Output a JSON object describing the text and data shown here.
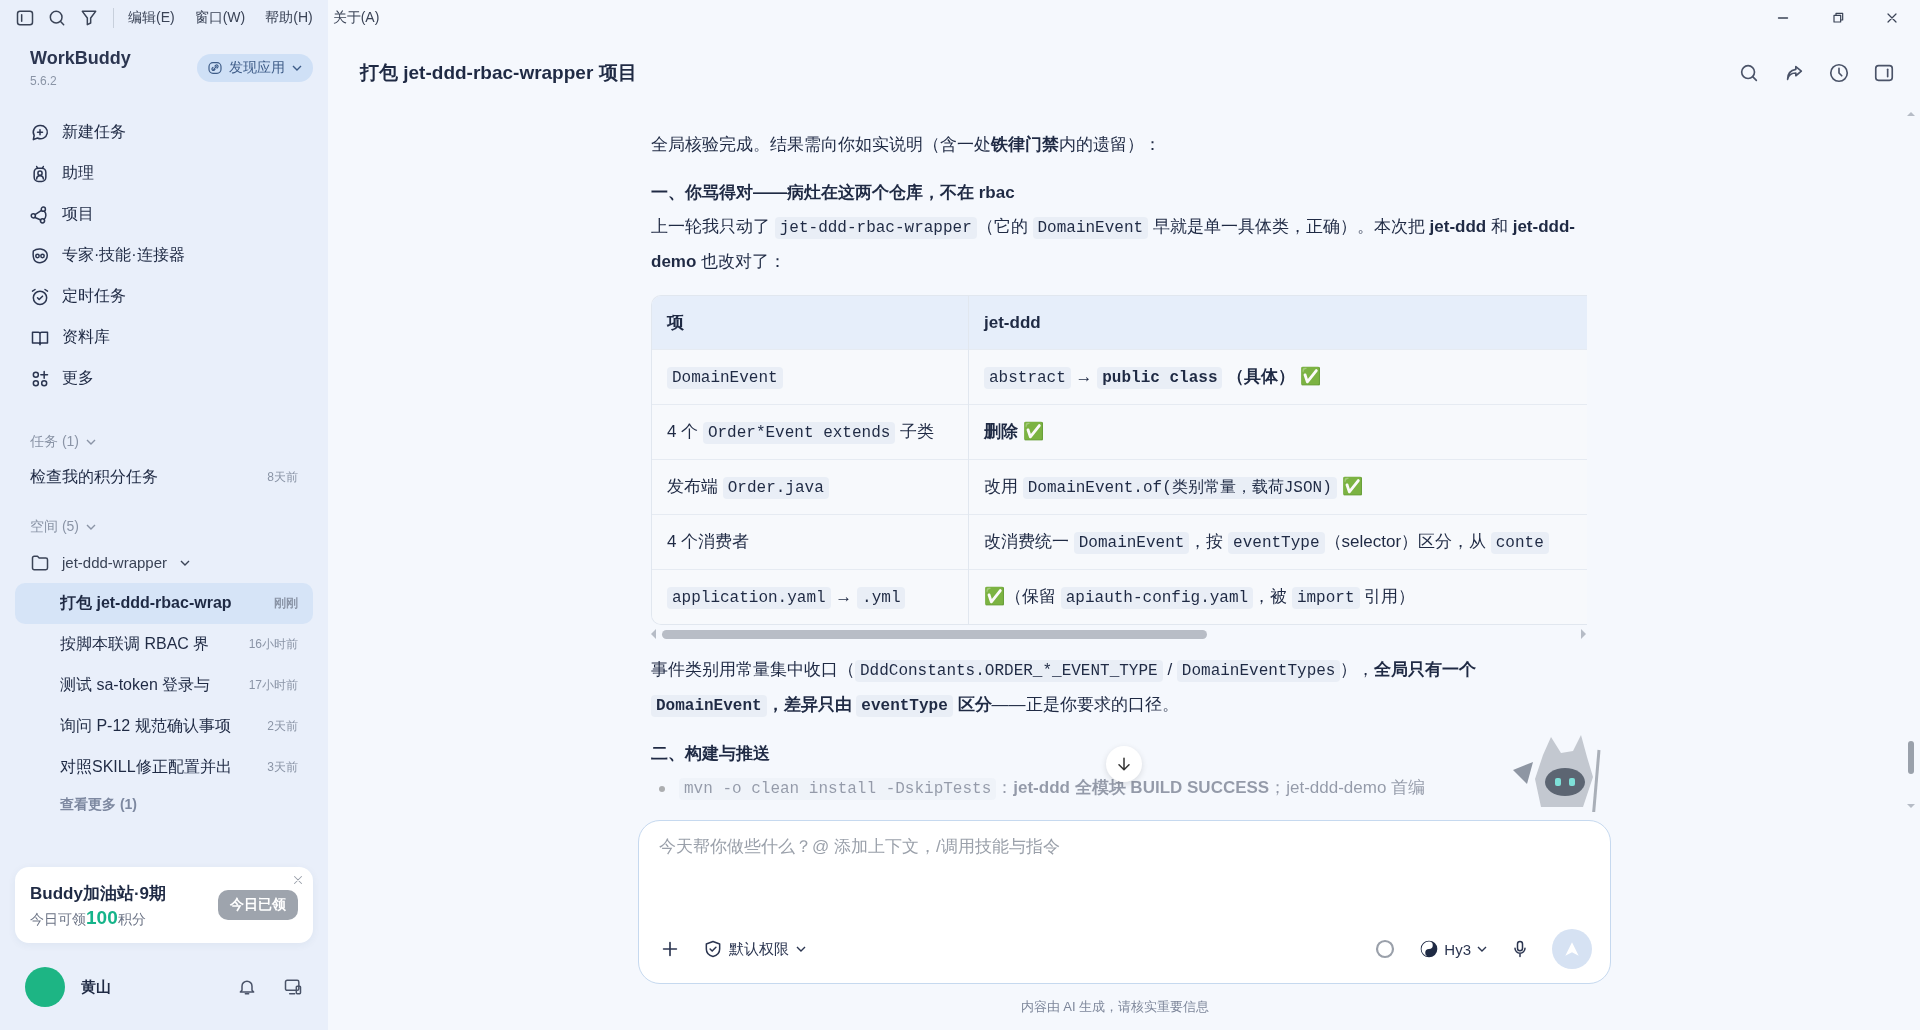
{
  "menu": [
    "编辑(E)",
    "窗口(W)",
    "帮助(H)",
    "关于(A)"
  ],
  "app": {
    "name": "WorkBuddy",
    "version": "5.6.2",
    "discover_button": "发现应用"
  },
  "nav": [
    {
      "label": "新建任务",
      "kind": "new"
    },
    {
      "label": "助理",
      "kind": "assistant"
    },
    {
      "label": "项目",
      "kind": "project"
    },
    {
      "label": "专家·技能·连接器",
      "kind": "expert"
    },
    {
      "label": "定时任务",
      "kind": "timer"
    },
    {
      "label": "资料库",
      "kind": "library"
    },
    {
      "label": "更多",
      "kind": "more"
    }
  ],
  "tasks": {
    "title": "任务 (1)",
    "expanded": true,
    "items": [
      {
        "label": "检查我的积分任务",
        "time": "8天前"
      }
    ]
  },
  "spaces": {
    "title": "空间 (5)",
    "expanded": true,
    "folder": {
      "label": "jet-ddd-wrapper",
      "expanded": true,
      "items": [
        {
          "label": "打包 jet-ddd-rbac-wrap",
          "time": "刚刚",
          "selected": true
        },
        {
          "label": "按脚本联调 RBAC 界",
          "time": "16小时前",
          "selected": false
        },
        {
          "label": "测试 sa-token 登录与",
          "time": "17小时前",
          "selected": false
        },
        {
          "label": "询问 P-12 规范确认事项",
          "time": "2天前",
          "selected": false
        },
        {
          "label": "对照SKILL修正配置并出",
          "time": "3天前",
          "selected": false
        }
      ]
    },
    "more": "查看更多 (1)"
  },
  "promo": {
    "title": "Buddy加油站·9期",
    "text": "今日可领**100**积分",
    "button": "今日已领",
    "disabled": true
  },
  "user": {
    "name": "黄山"
  },
  "chat": {
    "title": "打包 jet-ddd-rbac-wrapper 项目",
    "blocks": [
      {
        "kind": "paragraph",
        "segments": [
          {
            "kind": "text",
            "text": "全局核验完成。结果需向你如实说明（含一处**铁律门禁**内的遗留）："
          }
        ]
      },
      {
        "kind": "heading",
        "text": "一、你骂得对——病灶在这两个仓库，不在 rbac"
      },
      {
        "kind": "paragraph",
        "segments": [
          {
            "kind": "text",
            "text": "上一轮我只动了 "
          },
          {
            "kind": "code",
            "text": "jet-ddd-rbac-wrapper"
          },
          {
            "kind": "text",
            "text": "（它的 "
          },
          {
            "kind": "code",
            "text": "DomainEvent"
          },
          {
            "kind": "text",
            "text": " 早就是单一具体类，正确）。本次把 **jet-ddd** 和 **jet-ddd-demo** 也改对了："
          }
        ]
      },
      {
        "kind": "table",
        "columns": [
          "项",
          "jet-ddd"
        ],
        "rows": [
          [
            [
              {
                "kind": "code",
                "text": "DomainEvent"
              }
            ],
            [
              {
                "kind": "code",
                "text": "abstract"
              },
              {
                "kind": "text",
                "text": " → "
              },
              {
                "kind": "code",
                "text": "public class",
                "bold": true
              },
              {
                "kind": "text",
                "text": " **（具体）** "
              },
              {
                "kind": "check",
                "text": "✅"
              }
            ]
          ],
          [
            [
              {
                "kind": "text",
                "text": "4 个 "
              },
              {
                "kind": "code",
                "text": "Order*Event extends"
              },
              {
                "kind": "text",
                "text": " 子类"
              }
            ],
            [
              {
                "kind": "text",
                "text": "**删除** "
              },
              {
                "kind": "check",
                "text": "✅"
              }
            ]
          ],
          [
            [
              {
                "kind": "text",
                "text": "发布端 "
              },
              {
                "kind": "code",
                "text": "Order.java"
              }
            ],
            [
              {
                "kind": "text",
                "text": "改用 "
              },
              {
                "kind": "code",
                "text": "DomainEvent.of(类别常量，载荷JSON)"
              },
              {
                "kind": "text",
                "text": " "
              },
              {
                "kind": "check",
                "text": "✅"
              }
            ]
          ],
          [
            [
              {
                "kind": "text",
                "text": "4 个消费者"
              }
            ],
            [
              {
                "kind": "text",
                "text": "改消费统一 "
              },
              {
                "kind": "code",
                "text": "DomainEvent"
              },
              {
                "kind": "text",
                "text": "，按 "
              },
              {
                "kind": "code",
                "text": "eventType"
              },
              {
                "kind": "text",
                "text": "（selector）区分，从 "
              },
              {
                "kind": "code",
                "text": "conte"
              }
            ]
          ],
          [
            [
              {
                "kind": "code",
                "text": "application.yaml"
              },
              {
                "kind": "text",
                "text": " → "
              },
              {
                "kind": "code",
                "text": ".yml"
              }
            ],
            [
              {
                "kind": "check",
                "text": "✅"
              },
              {
                "kind": "text",
                "text": "（保留 "
              },
              {
                "kind": "code",
                "text": "apiauth-config.yaml"
              },
              {
                "kind": "text",
                "text": "，被 "
              },
              {
                "kind": "code",
                "text": "import"
              },
              {
                "kind": "text",
                "text": " 引用）"
              }
            ]
          ]
        ]
      },
      {
        "kind": "paragraph",
        "segments": [
          {
            "kind": "text",
            "text": "事件类别用常量集中收口（"
          },
          {
            "kind": "code",
            "text": "DddConstants.ORDER_*_EVENT_TYPE"
          },
          {
            "kind": "text",
            "text": " / "
          },
          {
            "kind": "code",
            "text": "DomainEventTypes"
          },
          {
            "kind": "text",
            "text": "），**全局只有一个** "
          },
          {
            "kind": "code",
            "text": "DomainEvent",
            "bold": true
          },
          {
            "kind": "text",
            "text": "**，差异只由** "
          },
          {
            "kind": "code",
            "text": "eventType",
            "bold": true
          },
          {
            "kind": "text",
            "text": " **区分**——正是你要求的口径。"
          }
        ]
      },
      {
        "kind": "heading",
        "text": "二、构建与推送"
      },
      {
        "kind": "bullet",
        "segments": [
          {
            "kind": "code",
            "text": "mvn -o clean install -DskipTests"
          },
          {
            "kind": "text",
            "text": "：**jet-ddd 全模块 BUILD SUCCESS**；jet-ddd-demo 首编"
          }
        ]
      }
    ]
  },
  "input": {
    "placeholder": "今天帮你做些什么？@ 添加上下文，/调用技能与指令",
    "permission": "默认权限",
    "model": "Hy3"
  },
  "disclaimer": "内容由 AI 生成，请核实重要信息"
}
